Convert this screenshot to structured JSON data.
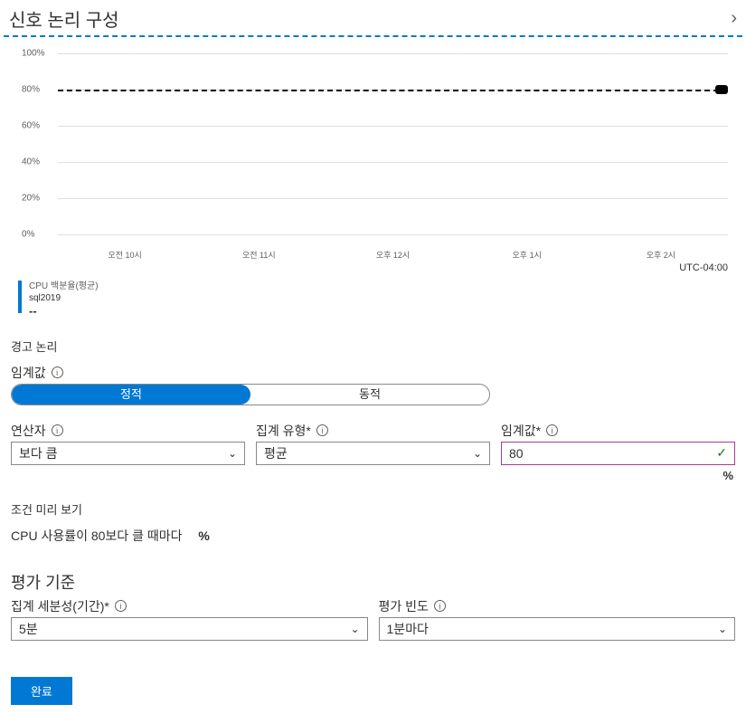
{
  "header": {
    "title": "신호 논리 구성"
  },
  "chart_data": {
    "type": "line",
    "ylim": [
      0,
      100
    ],
    "yticks": [
      "100%",
      "80%",
      "60%",
      "40%",
      "20%",
      "0%"
    ],
    "yvalues": [
      100,
      80,
      60,
      40,
      20,
      0
    ],
    "xticks": [
      "오전 10시",
      "오전 11시",
      "오후 12시",
      "오후 1시",
      "오후 2시"
    ],
    "threshold": 80,
    "timezone": "UTC-04:00",
    "series": [
      {
        "name": "CPU 백분율(평균)",
        "resource": "sql2019",
        "value": "--"
      }
    ]
  },
  "alert_logic": {
    "section_label": "경고 논리",
    "threshold_label": "임계값",
    "toggle": {
      "static": "정적",
      "dynamic": "동적"
    },
    "operator": {
      "label": "연산자",
      "value": "보다 큼"
    },
    "aggregation": {
      "label": "집계 유형*",
      "value": "평균"
    },
    "threshold_value": {
      "label": "임계값*",
      "value": "80",
      "unit": "%"
    }
  },
  "preview": {
    "label": "조건 미리 보기",
    "text": "CPU 사용률이 80보다 클 때마다",
    "unit": "%"
  },
  "evaluation": {
    "heading": "평가 기준",
    "granularity": {
      "label": "집계 세분성(기간)*",
      "value": "5분"
    },
    "frequency": {
      "label": "평가 빈도",
      "value": "1분마다"
    }
  },
  "footer": {
    "done": "완료"
  }
}
